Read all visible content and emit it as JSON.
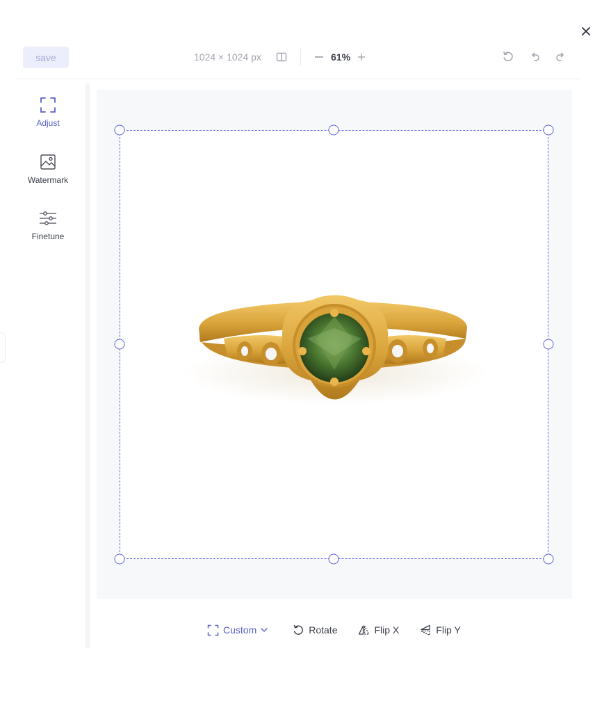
{
  "toolbar": {
    "save_label": "save",
    "dimensions": "1024 × 1024 px",
    "zoom": "61%"
  },
  "sidebar": {
    "items": [
      {
        "label": "Adjust",
        "icon": "crop-frame-icon",
        "active": true
      },
      {
        "label": "Watermark",
        "icon": "image-icon",
        "active": false
      },
      {
        "label": "Finetune",
        "icon": "sliders-icon",
        "active": false
      }
    ]
  },
  "bottom": {
    "custom_label": "Custom",
    "rotate_label": "Rotate",
    "flipx_label": "Flip X",
    "flipy_label": "Flip Y"
  },
  "colors": {
    "accent": "#5a61c9",
    "crop_border": "#5a63d8",
    "save_bg": "#eceefb"
  }
}
